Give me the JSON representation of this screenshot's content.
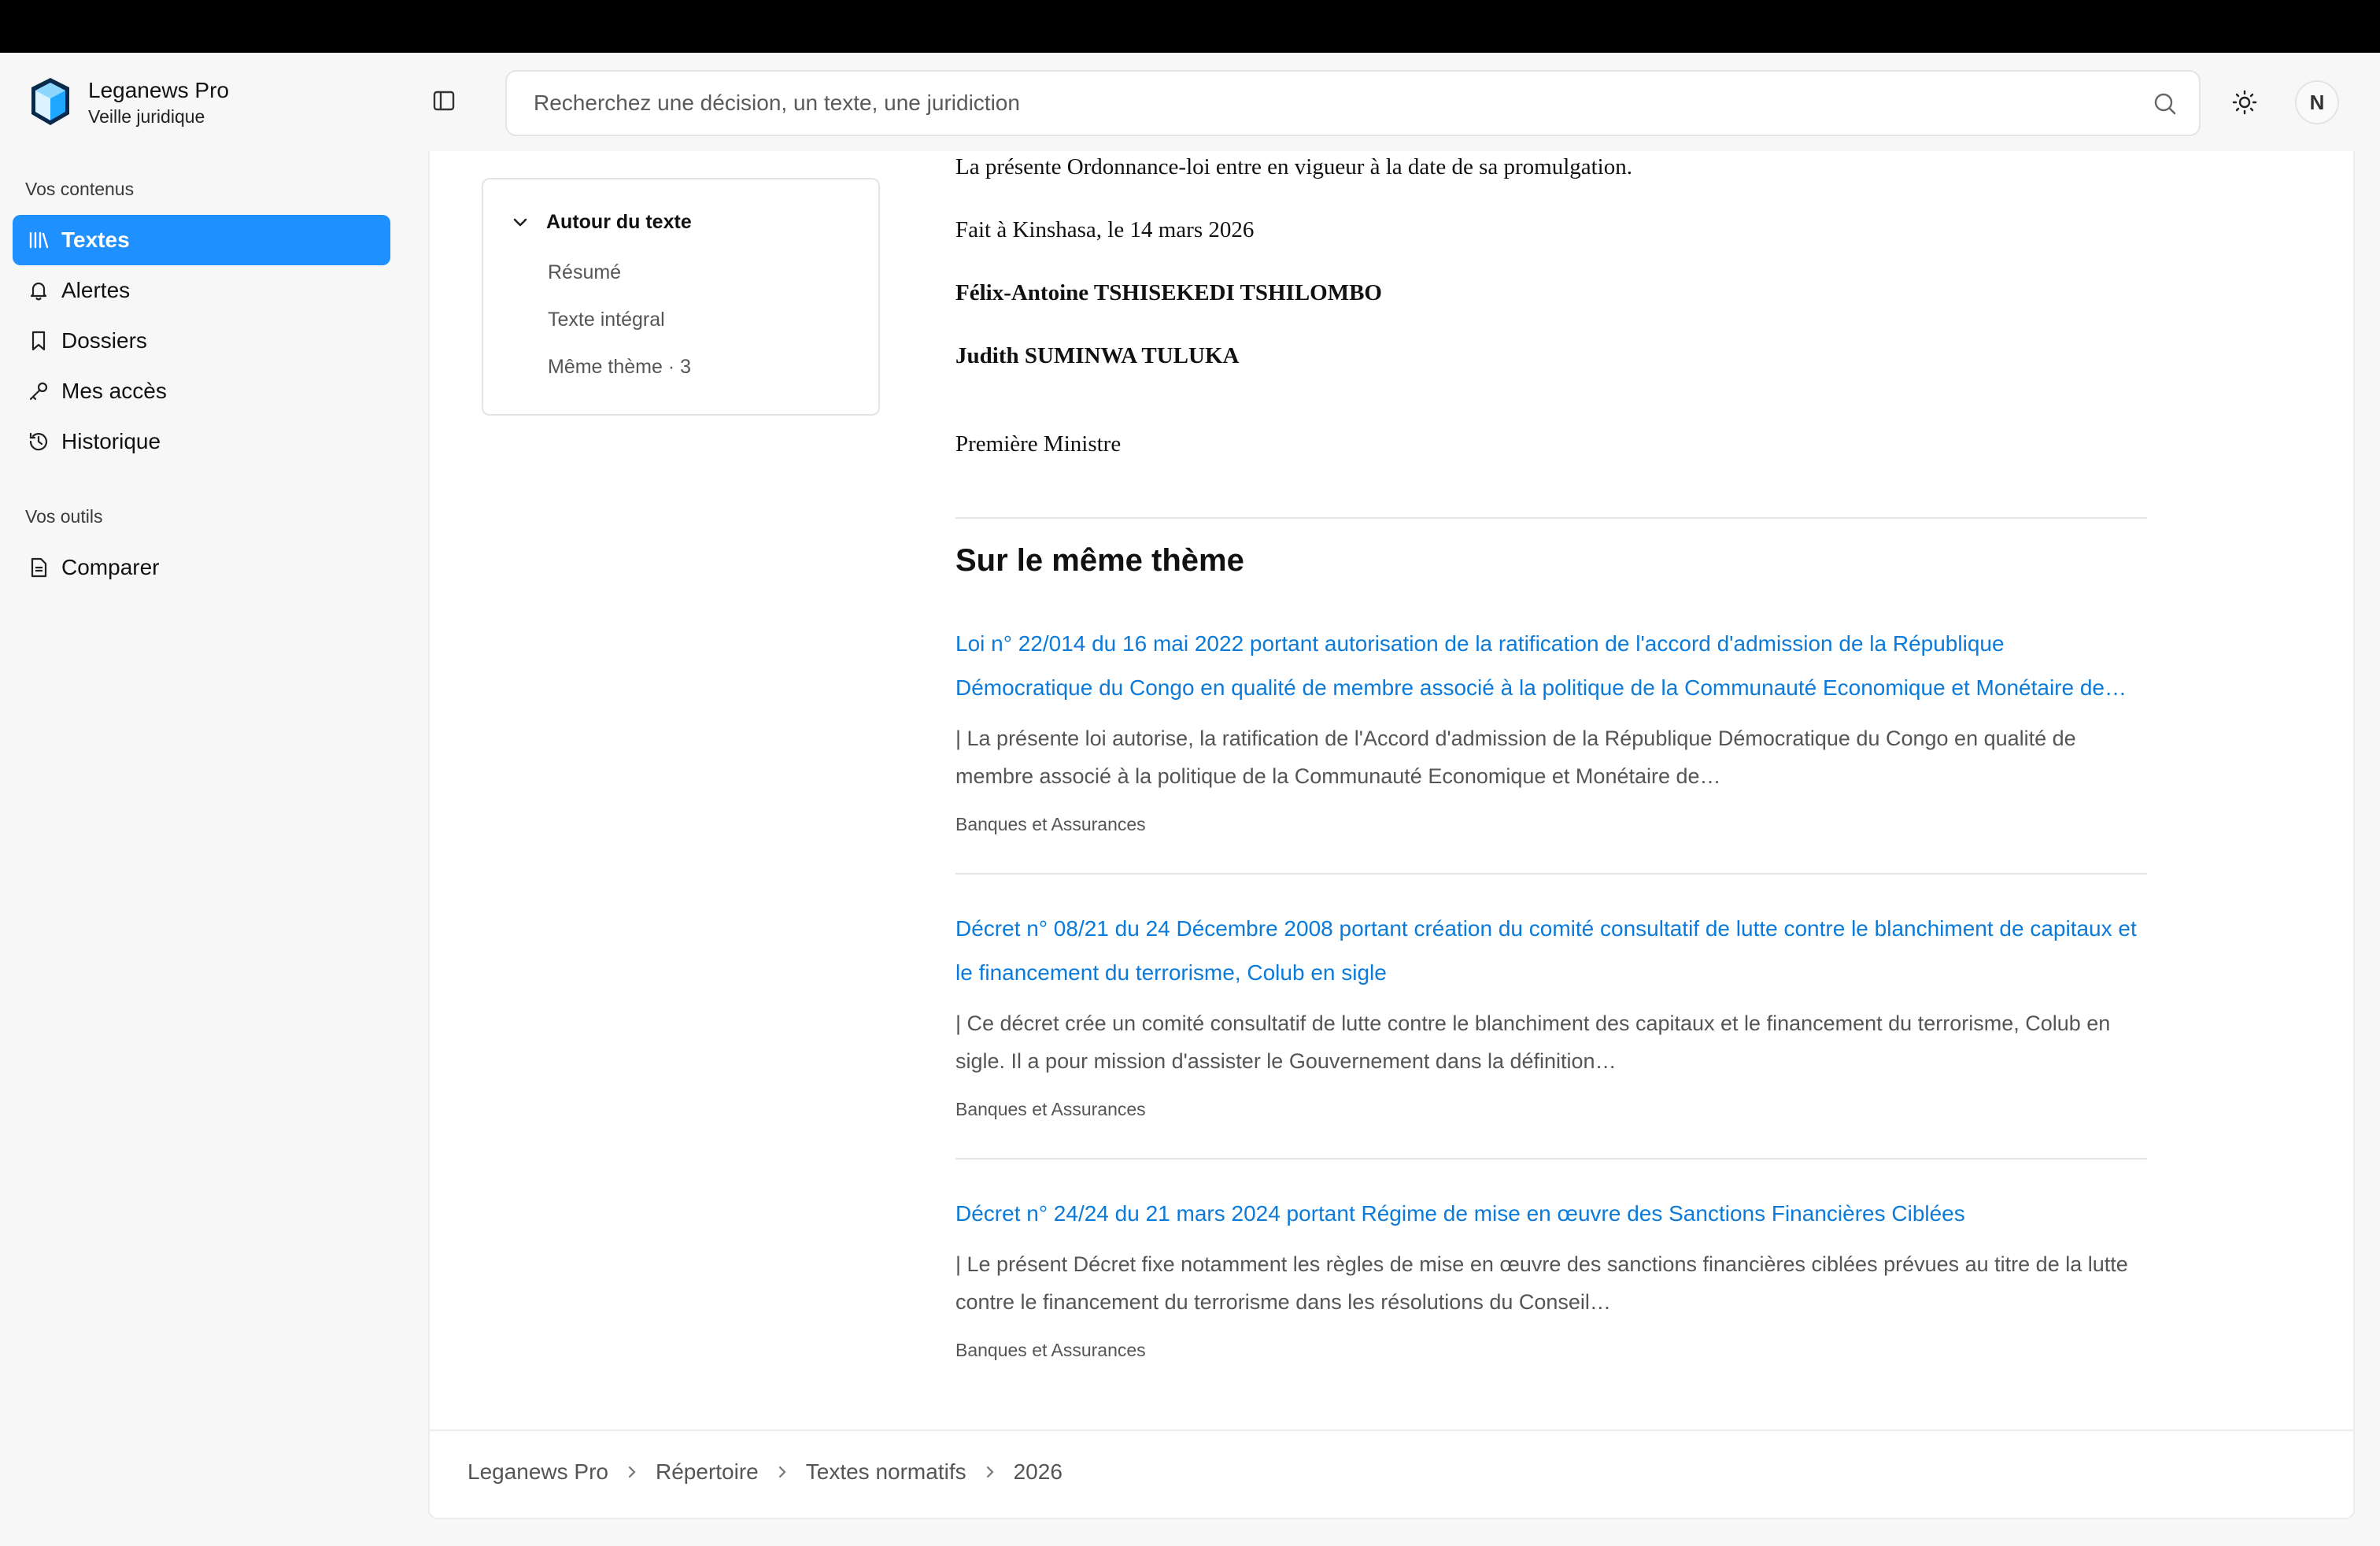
{
  "app": {
    "name": "Leganews Pro",
    "subtitle": "Veille juridique"
  },
  "sidebar": {
    "section1_label": "Vos contenus",
    "items": [
      {
        "label": "Textes",
        "icon": "library-icon",
        "active": true
      },
      {
        "label": "Alertes",
        "icon": "bell-icon"
      },
      {
        "label": "Dossiers",
        "icon": "bookmark-icon"
      },
      {
        "label": "Mes accès",
        "icon": "key-icon"
      },
      {
        "label": "Historique",
        "icon": "history-icon"
      }
    ],
    "section2_label": "Vos outils",
    "tools": [
      {
        "label": "Comparer",
        "icon": "document-icon"
      }
    ]
  },
  "search": {
    "placeholder": "Recherchez une décision, un texte, une juridiction",
    "value": ""
  },
  "user": {
    "initial": "N"
  },
  "toc": {
    "title": "Autour du texte",
    "items": [
      "Résumé",
      "Texte intégral",
      "Même thème · 3"
    ]
  },
  "document": {
    "line1": "La présente Ordonnance-loi entre en vigueur à la date de sa promulgation.",
    "line2": "Fait à Kinshasa, le 14 mars 2026",
    "signatory1": "Félix-Antoine TSHISEKEDI TSHILOMBO",
    "signatory2": "Judith SUMINWA TULUKA",
    "role": "Première Ministre"
  },
  "same_theme": {
    "title": "Sur le même thème",
    "items": [
      {
        "title": "Loi n° 22/014 du 16 mai 2022 portant autorisation de la ratification de l'accord d'admission de la République Démocratique du Congo en qualité de membre associé à la politique de la Communauté Economique et Monétaire de…",
        "excerpt": "| La présente loi autorise, la ratification de l'Accord d'admission de la République Démocratique du Congo en qualité de membre associé à la politique de la Communauté Economique et Monétaire de…",
        "tag": "Banques et Assurances"
      },
      {
        "title": "Décret n° 08/21 du 24 Décembre 2008 portant création du comité consultatif de lutte contre le blanchiment de capitaux et le financement du terrorisme, Colub en sigle",
        "excerpt": "| Ce décret crée un comité consultatif de lutte contre le blanchiment des capitaux et le financement du terrorisme, Colub en sigle. Il a pour mission d'assister le Gouvernement dans la définition…",
        "tag": "Banques et Assurances"
      },
      {
        "title": "Décret n° 24/24 du 21 mars 2024 portant Régime de mise en œuvre des Sanctions Financières Ciblées",
        "excerpt": "| Le présent Décret fixe notamment les règles de mise en œuvre des sanctions financières ciblées prévues au titre de la lutte contre le financement du terrorisme dans les résolutions du Conseil…",
        "tag": "Banques et Assurances"
      }
    ]
  },
  "breadcrumb": [
    "Leganews Pro",
    "Répertoire",
    "Textes normatifs",
    "2026"
  ],
  "colors": {
    "accent": "#1e90ff",
    "link": "#0b7ad8"
  }
}
